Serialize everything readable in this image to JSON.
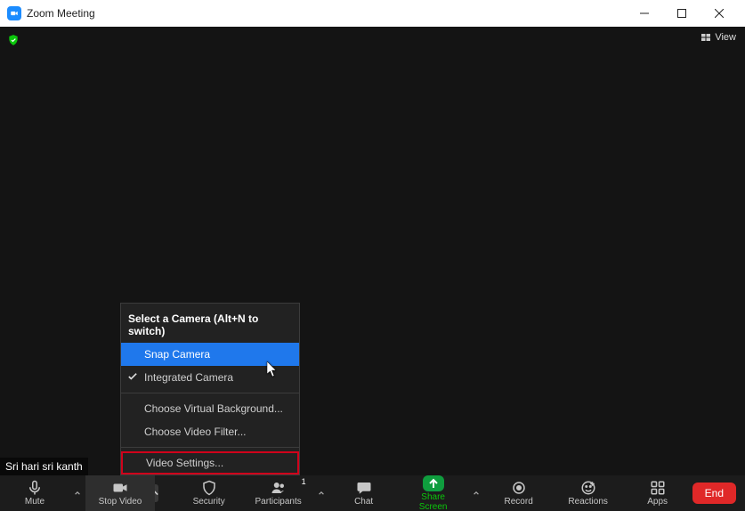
{
  "title": "Zoom Meeting",
  "header": {
    "view_label": "View"
  },
  "participant_name": "Sri hari sri kanth",
  "video_menu": {
    "header": "Select a Camera (Alt+N to switch)",
    "cam1": "Snap Camera",
    "cam2": "Integrated Camera",
    "opt_vb": "Choose Virtual Background...",
    "opt_filter": "Choose Video Filter...",
    "opt_settings": "Video Settings..."
  },
  "toolbar": {
    "mute": "Mute",
    "stop_video": "Stop Video",
    "security": "Security",
    "participants": "Participants",
    "participants_count": "1",
    "chat": "Chat",
    "share": "Share Screen",
    "record": "Record",
    "reactions": "Reactions",
    "apps": "Apps",
    "end": "End"
  }
}
